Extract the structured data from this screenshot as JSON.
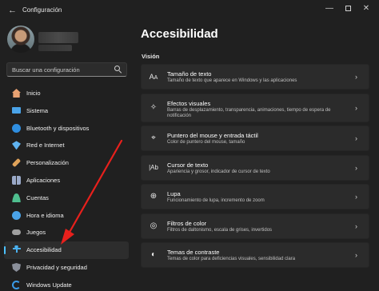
{
  "window": {
    "back_icon": "back-arrow-icon",
    "title": "Configuración",
    "minimize_symbol": "—",
    "close_symbol": "✕"
  },
  "search": {
    "placeholder": "Buscar una configuración",
    "icon": "search-icon"
  },
  "sidebar": {
    "items": [
      {
        "label": "Inicio",
        "icon": "home-icon",
        "color": "#e8a272"
      },
      {
        "label": "Sistema",
        "icon": "system-icon",
        "color": "#4aa3e8"
      },
      {
        "label": "Bluetooth y dispositivos",
        "icon": "bluetooth-icon",
        "color": "#2f8ee0"
      },
      {
        "label": "Red e Internet",
        "icon": "wifi-icon",
        "color": "#5fb3f0"
      },
      {
        "label": "Personalización",
        "icon": "paintbrush-icon",
        "color": "#e0a35a"
      },
      {
        "label": "Aplicaciones",
        "icon": "apps-icon",
        "color": "#9aa9c8"
      },
      {
        "label": "Cuentas",
        "icon": "account-icon",
        "color": "#4fbf8f"
      },
      {
        "label": "Hora e idioma",
        "icon": "clock-globe-icon",
        "color": "#4aa3e8"
      },
      {
        "label": "Juegos",
        "icon": "gamepad-icon",
        "color": "#a0a0a0"
      },
      {
        "label": "Accesibilidad",
        "icon": "accessibility-icon",
        "color": "#4ab0ee",
        "active": true
      },
      {
        "label": "Privacidad y seguridad",
        "icon": "shield-icon",
        "color": "#8a8f9a"
      },
      {
        "label": "Windows Update",
        "icon": "windows-update-icon",
        "color": "#3a9be8"
      }
    ]
  },
  "main": {
    "title": "Accesibilidad",
    "section": "Visión",
    "cards": [
      {
        "title": "Tamaño de texto",
        "desc": "Tamaño de texto que aparece en Windows y las aplicaciones",
        "icon": "text-size-icon"
      },
      {
        "title": "Efectos visuales",
        "desc": "Barras de desplazamiento, transparencia, animaciones, tiempo de espera de notificación",
        "icon": "visual-effects-icon"
      },
      {
        "title": "Puntero del mouse y entrada táctil",
        "desc": "Color de puntero del mouse, tamaño",
        "icon": "mouse-pointer-icon"
      },
      {
        "title": "Cursor de texto",
        "desc": "Apariencia y grosor, indicador de cursor de texto",
        "icon": "text-cursor-icon"
      },
      {
        "title": "Lupa",
        "desc": "Funcionamiento de lupa, incremento de zoom",
        "icon": "magnifier-icon"
      },
      {
        "title": "Filtros de color",
        "desc": "Filtros de daltonismo, escala de grises, invertidos",
        "icon": "color-filters-icon"
      },
      {
        "title": "Temas de contraste",
        "desc": "Temas de color para deficiencias visuales, sensibilidad clara",
        "icon": "contrast-themes-icon"
      }
    ],
    "chevron": "›"
  },
  "annotation": {
    "color": "#e8201c"
  }
}
